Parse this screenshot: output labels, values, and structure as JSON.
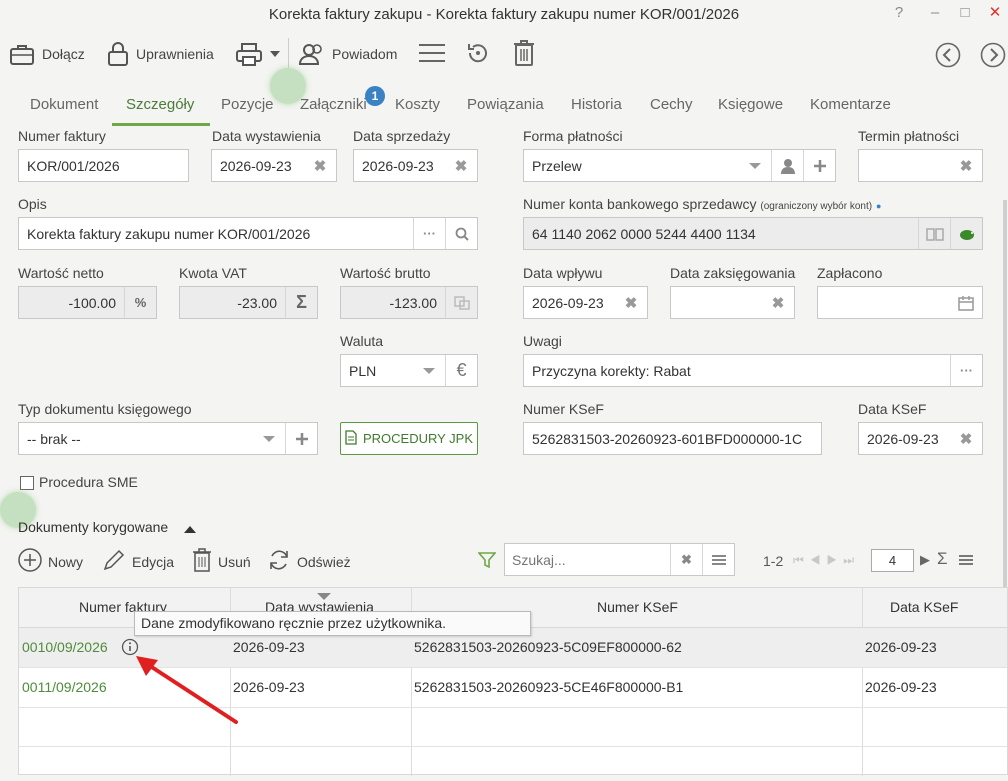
{
  "window": {
    "title": "Korekta faktury zakupu - Korekta faktury zakupu numer KOR/001/2026",
    "help": "?",
    "minimize": "–",
    "maximize": "□",
    "close": "✕"
  },
  "toolbar": {
    "attach": "Dołącz",
    "permissions": "Uprawnienia",
    "notify": "Powiadom"
  },
  "tabs": [
    {
      "label": "Dokument"
    },
    {
      "label": "Szczegóły"
    },
    {
      "label": "Pozycje"
    },
    {
      "label": "Załączniki",
      "badge": "1"
    },
    {
      "label": "Koszty"
    },
    {
      "label": "Powiązania"
    },
    {
      "label": "Historia"
    },
    {
      "label": "Cechy"
    },
    {
      "label": "Księgowe"
    },
    {
      "label": "Komentarze"
    }
  ],
  "active_tab": "Szczegóły",
  "form": {
    "invoice_number_label": "Numer faktury",
    "invoice_number": "KOR/001/2026",
    "issue_date_label": "Data wystawienia",
    "issue_date": "2026-09-23",
    "sale_date_label": "Data sprzedaży",
    "sale_date": "2026-09-23",
    "payment_form_label": "Forma płatności",
    "payment_form": "Przelew",
    "payment_term_label": "Termin płatności",
    "payment_term": "",
    "description_label": "Opis",
    "description": "Korekta faktury zakupu numer KOR/001/2026",
    "bank_account_label": "Numer konta bankowego sprzedawcy",
    "bank_account_note": "(ograniczony wybór kont)",
    "bank_account": "64 1140 2062 0000 5244 4400 1134",
    "net_label": "Wartość netto",
    "net": "-100.00",
    "net_btn": "%",
    "vat_label": "Kwota VAT",
    "vat": "-23.00",
    "vat_btn": "Σ",
    "gross_label": "Wartość brutto",
    "gross": "-123.00",
    "receipt_date_label": "Data wpływu",
    "receipt_date": "2026-09-23",
    "booking_date_label": "Data zaksięgowania",
    "booking_date": "",
    "paid_label": "Zapłacono",
    "paid": "",
    "currency_label": "Waluta",
    "currency": "PLN",
    "currency_btn": "€",
    "notes_label": "Uwagi",
    "notes": "Przyczyna korekty: Rabat",
    "acc_doc_type_label": "Typ dokumentu księgowego",
    "acc_doc_type": "-- brak --",
    "jpk_button": "PROCEDURY JPK",
    "ksef_number_label": "Numer KSeF",
    "ksef_number": "5262831503-20260923-601BFD000000-1C",
    "ksef_date_label": "Data KSeF",
    "ksef_date": "2026-09-23",
    "sme_label": "Procedura SME"
  },
  "corrected": {
    "section_title": "Dokumenty korygowane",
    "new": "Nowy",
    "edit": "Edycja",
    "delete": "Usuń",
    "refresh": "Odśwież",
    "search_placeholder": "Szukaj...",
    "range": "1-2",
    "page_size": "4",
    "columns": [
      "Numer faktury",
      "Data wystawienia",
      "Numer KSeF",
      "Data KSeF"
    ],
    "rows": [
      {
        "invoice": "0010/09/2026",
        "issue_date": "2026-09-23",
        "ksef": "5262831503-20260923-5C09EF800000-62",
        "ksef_date": "2026-09-23"
      },
      {
        "invoice": "0011/09/2026",
        "issue_date": "2026-09-23",
        "ksef": "5262831503-20260923-5CE46F800000-B1",
        "ksef_date": "2026-09-23"
      }
    ],
    "tooltip": "Dane zmodyfikowano ręcznie przez użytkownika."
  },
  "colors": {
    "accent": "#6fa648",
    "link": "#4f8c3a",
    "badge": "#3b82c4",
    "arrow": "#e02020"
  }
}
